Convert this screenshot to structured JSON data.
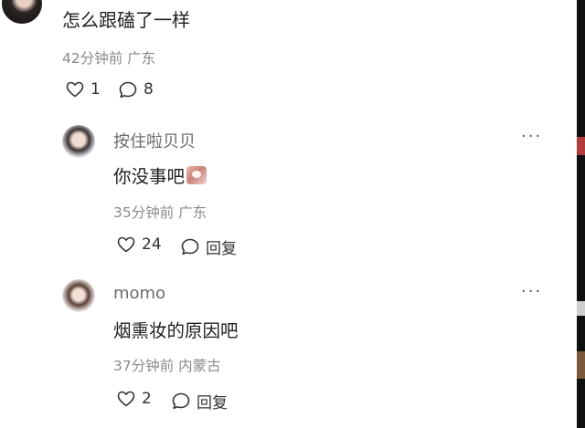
{
  "top_comment": {
    "text": "怎么跟磕了一样",
    "time": "42分钟前",
    "location": "广东",
    "likes": "1",
    "replies": "8"
  },
  "replies": [
    {
      "username": "按住啦贝贝",
      "text": "你没事吧",
      "time": "35分钟前",
      "location": "广东",
      "likes": "24",
      "reply_label": "回复",
      "more": "···"
    },
    {
      "username": "momo",
      "text": "烟熏妆的原因吧",
      "time": "37分钟前",
      "location": "内蒙古",
      "likes": "2",
      "reply_label": "回复",
      "more": "···"
    }
  ],
  "icons": {
    "like": "heart-outline-icon",
    "comment": "speech-bubble-icon",
    "more": "ellipsis-icon"
  }
}
